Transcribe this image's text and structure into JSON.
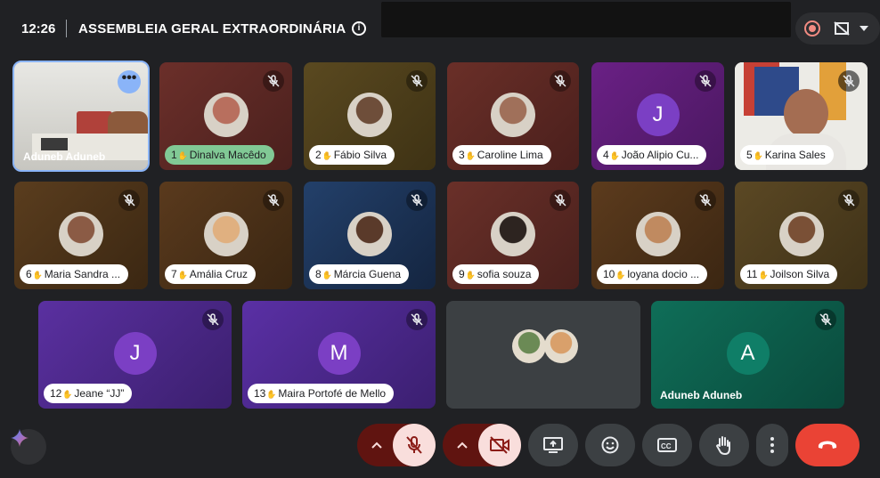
{
  "header": {
    "time": "12:26",
    "title": "ASSEMBLEIA GERAL EXTRAORDINÁRIA",
    "info_icon": "info-icon",
    "record_icon": "record-icon",
    "no_stream_icon": "no-stream-icon"
  },
  "tiles": [
    {
      "name": "Aduneb Aduneb",
      "number": "",
      "type": "video-room"
    },
    {
      "name": "Dinalva Macêdo",
      "number": "1",
      "type": "photo",
      "highlight": "#81c995"
    },
    {
      "name": "Fábio Silva",
      "number": "2",
      "type": "photo"
    },
    {
      "name": "Caroline Lima",
      "number": "3",
      "type": "photo"
    },
    {
      "name": "João Alipio Cu...",
      "number": "4",
      "type": "letter",
      "letter": "J"
    },
    {
      "name": "Karina Sales",
      "number": "5",
      "type": "video-person"
    },
    {
      "name": "Maria Sandra ...",
      "number": "6",
      "type": "photo"
    },
    {
      "name": "Amália Cruz",
      "number": "7",
      "type": "photo"
    },
    {
      "name": "Márcia Guena",
      "number": "8",
      "type": "photo"
    },
    {
      "name": "sofia souza",
      "number": "9",
      "type": "photo"
    },
    {
      "name": "loyana docio ...",
      "number": "10",
      "type": "photo"
    },
    {
      "name": "Joilson Silva",
      "number": "11",
      "type": "photo"
    },
    {
      "name": "Jeane “JJ”",
      "number": "12",
      "type": "letter",
      "letter": "J"
    },
    {
      "name": "Maira Portofé de Mello",
      "number": "13",
      "type": "letter",
      "letter": "M"
    },
    {
      "name": "",
      "number": "",
      "type": "others"
    },
    {
      "name": "Aduneb Aduneb",
      "number": "",
      "type": "letter",
      "letter": "A"
    }
  ],
  "colors": {
    "background": "#202124",
    "end_call": "#ea4335",
    "mic_off_bg": "#f9dedc",
    "mic_off_icon": "#8c1d18",
    "raised_hand_pill": "#81c995"
  },
  "controls": {
    "gemini_icon": "gemini-icon",
    "mic": "mic-off-icon",
    "camera": "camera-off-icon",
    "present": "present-screen-icon",
    "emoji": "emoji-icon",
    "captions": "captions-icon",
    "hand": "raise-hand-icon",
    "more": "more-vert-icon",
    "leave": "call-end-icon"
  }
}
